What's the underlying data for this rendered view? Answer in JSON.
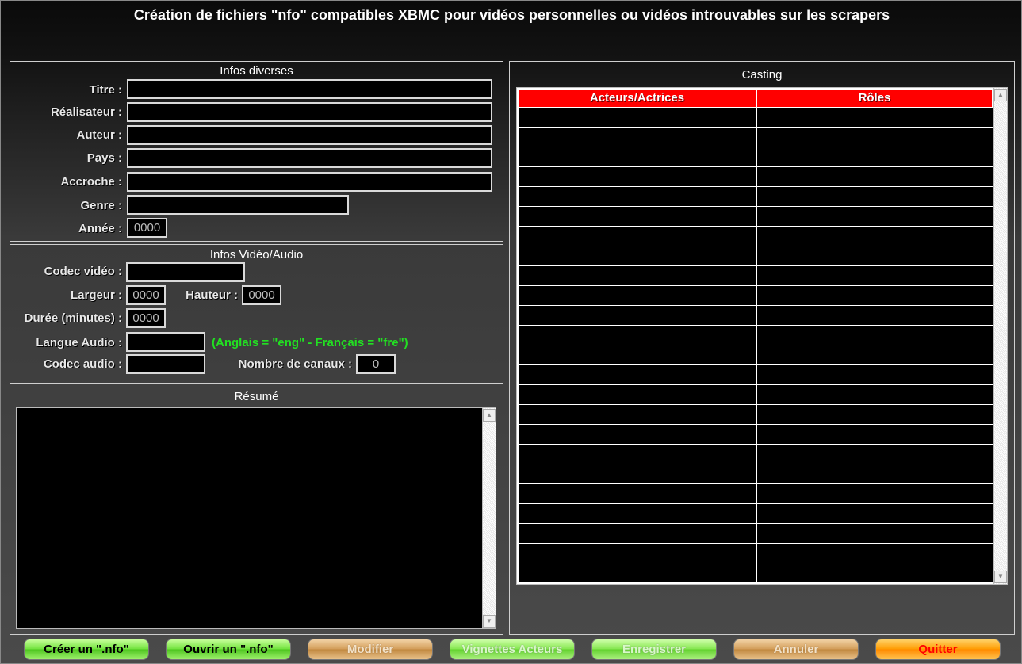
{
  "title": "Création de fichiers \"nfo\" compatibles XBMC pour vidéos personnelles ou vidéos introuvables sur les scrapers",
  "infos_diverses": {
    "heading": "Infos diverses",
    "titre_label": "Titre :",
    "titre_value": "",
    "realisateur_label": "Réalisateur :",
    "realisateur_value": "",
    "auteur_label": "Auteur :",
    "auteur_value": "",
    "pays_label": "Pays :",
    "pays_value": "",
    "accroche_label": "Accroche :",
    "accroche_value": "",
    "genre_label": "Genre :",
    "genre_value": "",
    "annee_label": "Année :",
    "annee_value": "0000"
  },
  "infos_video_audio": {
    "heading": "Infos Vidéo/Audio",
    "codec_video_label": "Codec vidéo :",
    "codec_video_value": "",
    "largeur_label": "Largeur :",
    "largeur_value": "0000",
    "hauteur_label": "Hauteur :",
    "hauteur_value": "0000",
    "duree_label": "Durée (minutes) :",
    "duree_value": "0000",
    "langue_audio_label": "Langue Audio :",
    "langue_audio_value": "",
    "langue_hint": "(Anglais = \"eng\" -  Français = \"fre\")",
    "codec_audio_label": "Codec audio :",
    "codec_audio_value": "",
    "canaux_label": "Nombre de canaux :",
    "canaux_value": "0"
  },
  "resume": {
    "heading": "Résumé",
    "value": ""
  },
  "casting": {
    "heading": "Casting",
    "columns": [
      "Acteurs/Actrices",
      "Rôles"
    ]
  },
  "buttons": {
    "creer": "Créer un \".nfo\"",
    "ouvrir": "Ouvrir un \".nfo\"",
    "modifier": "Modifier",
    "vignettes": "Vignettes Acteurs",
    "enregistrer": "Enregistrer",
    "annuler": "Annuler",
    "quitter": "Quitter"
  },
  "colors": {
    "grid_header": "#ff0000",
    "hint": "#22e022",
    "quit_text": "#ff0000"
  }
}
